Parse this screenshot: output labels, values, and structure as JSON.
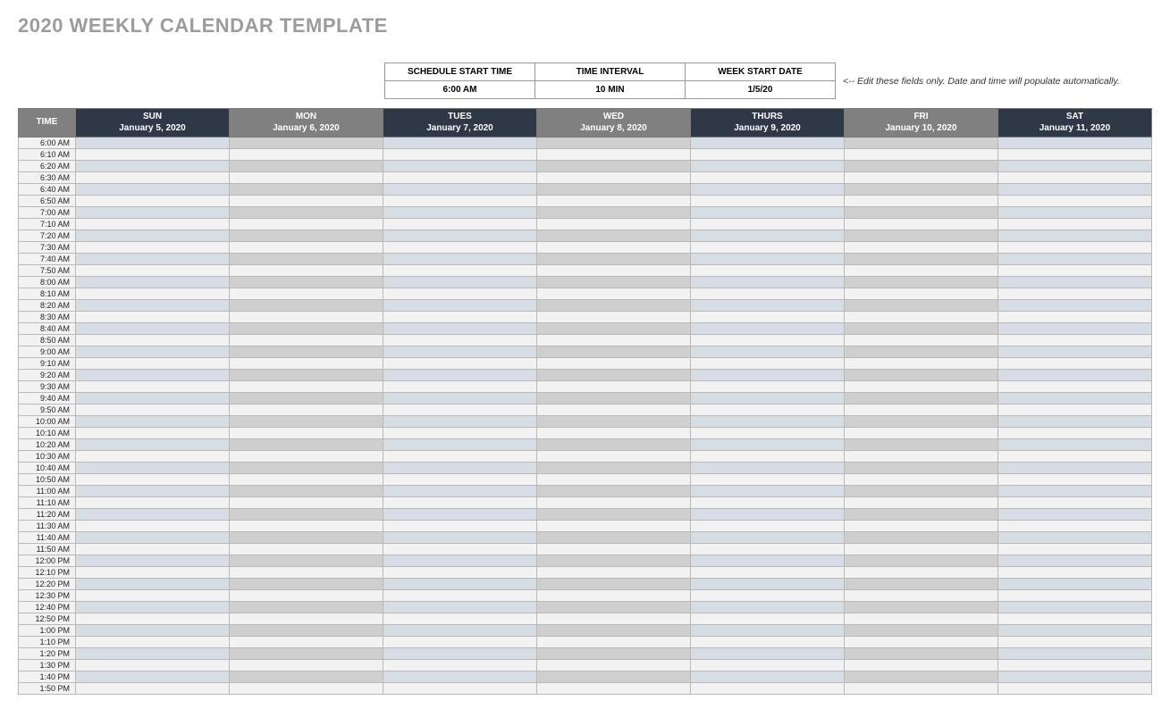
{
  "title": "2020 WEEKLY CALENDAR TEMPLATE",
  "settings": {
    "headers": {
      "start_time": "SCHEDULE START TIME",
      "interval": "TIME INTERVAL",
      "week_start": "WEEK START DATE"
    },
    "values": {
      "start_time": "6:00 AM",
      "interval": "10 MIN",
      "week_start": "1/5/20"
    },
    "hint": "<-- Edit these fields only. Date and time will populate automatically."
  },
  "calendar": {
    "time_header": "TIME",
    "days": [
      {
        "name": "SUN",
        "date": "January 5, 2020",
        "gray": false
      },
      {
        "name": "MON",
        "date": "January 6, 2020",
        "gray": true
      },
      {
        "name": "TUES",
        "date": "January 7, 2020",
        "gray": false
      },
      {
        "name": "WED",
        "date": "January 8, 2020",
        "gray": true
      },
      {
        "name": "THURS",
        "date": "January 9, 2020",
        "gray": false
      },
      {
        "name": "FRI",
        "date": "January 10, 2020",
        "gray": true
      },
      {
        "name": "SAT",
        "date": "January 11, 2020",
        "gray": false
      }
    ],
    "times": [
      "6:00 AM",
      "6:10 AM",
      "6:20 AM",
      "6:30 AM",
      "6:40 AM",
      "6:50 AM",
      "7:00 AM",
      "7:10 AM",
      "7:20 AM",
      "7:30 AM",
      "7:40 AM",
      "7:50 AM",
      "8:00 AM",
      "8:10 AM",
      "8:20 AM",
      "8:30 AM",
      "8:40 AM",
      "8:50 AM",
      "9:00 AM",
      "9:10 AM",
      "9:20 AM",
      "9:30 AM",
      "9:40 AM",
      "9:50 AM",
      "10:00 AM",
      "10:10 AM",
      "10:20 AM",
      "10:30 AM",
      "10:40 AM",
      "10:50 AM",
      "11:00 AM",
      "11:10 AM",
      "11:20 AM",
      "11:30 AM",
      "11:40 AM",
      "11:50 AM",
      "12:00 PM",
      "12:10 PM",
      "12:20 PM",
      "12:30 PM",
      "12:40 PM",
      "12:50 PM",
      "1:00 PM",
      "1:10 PM",
      "1:20 PM",
      "1:30 PM",
      "1:40 PM",
      "1:50 PM"
    ]
  }
}
